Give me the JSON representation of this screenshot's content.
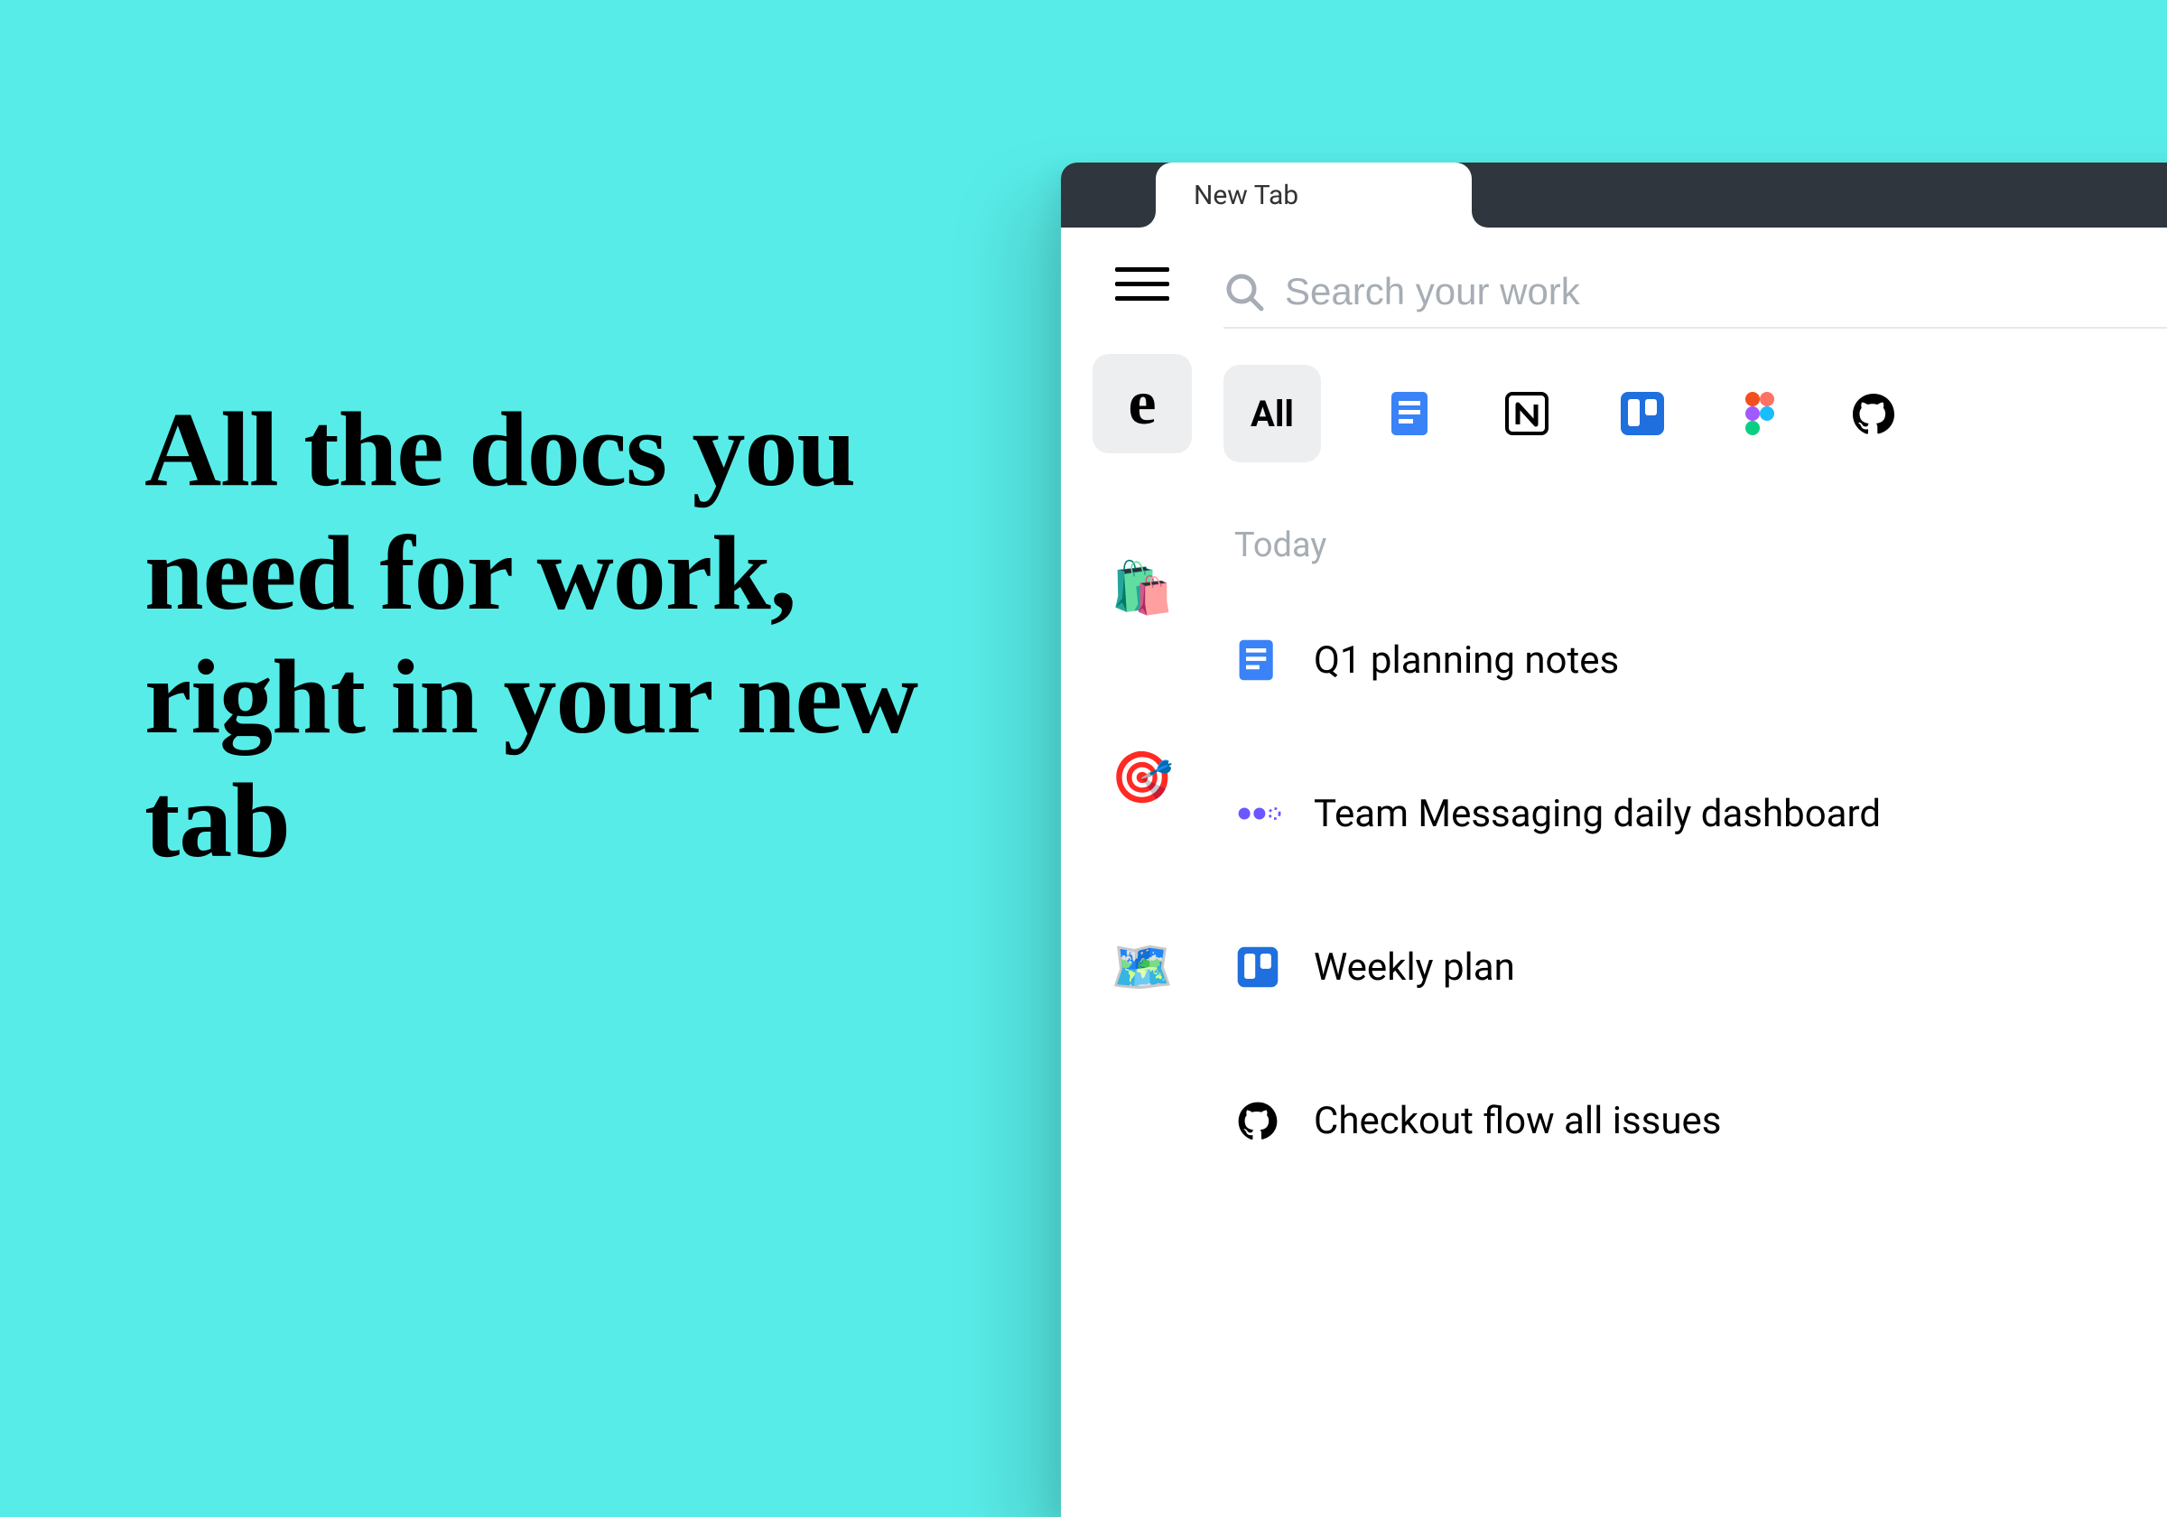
{
  "marketing": {
    "headline": "All the docs you need for work, right in your new tab"
  },
  "browser": {
    "tab_label": "New Tab"
  },
  "search": {
    "placeholder": "Search your work"
  },
  "filters": {
    "all_label": "All",
    "sources": [
      "google-docs",
      "notion",
      "trello",
      "figma",
      "github"
    ]
  },
  "sidebar": {
    "spaces": [
      "shopping-bags",
      "target",
      "world-map"
    ]
  },
  "docs": {
    "section_label": "Today",
    "items": [
      {
        "source": "google-docs",
        "title": "Q1 planning notes"
      },
      {
        "source": "dots",
        "title": "Team Messaging daily dashboard"
      },
      {
        "source": "trello",
        "title": "Weekly plan"
      },
      {
        "source": "github",
        "title": "Checkout flow all issues"
      }
    ]
  }
}
